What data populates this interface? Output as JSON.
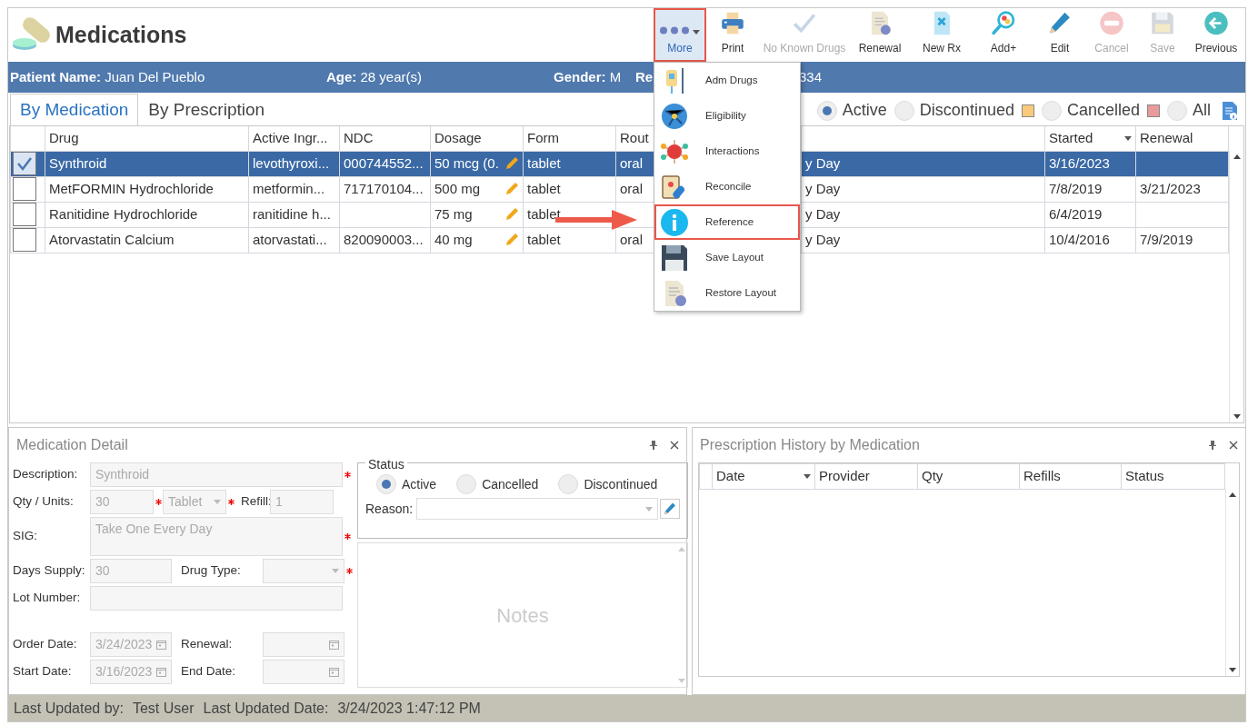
{
  "header": {
    "title": "Medications"
  },
  "toolbar": [
    {
      "label": "More",
      "kind": "more",
      "disabled": false,
      "highlighted": true
    },
    {
      "label": "Print",
      "kind": "print",
      "disabled": false,
      "highlighted": false
    },
    {
      "label": "No Known Drugs",
      "kind": "no-known-drugs",
      "disabled": true,
      "highlighted": false
    },
    {
      "label": "Renewal",
      "kind": "renewal",
      "disabled": false,
      "highlighted": false
    },
    {
      "label": "New Rx",
      "kind": "new-rx",
      "disabled": false,
      "highlighted": false
    },
    {
      "label": "Add+",
      "kind": "add",
      "disabled": false,
      "highlighted": false
    },
    {
      "label": "Edit",
      "kind": "edit",
      "disabled": false,
      "highlighted": false
    },
    {
      "label": "Cancel",
      "kind": "cancel",
      "disabled": true,
      "highlighted": false
    },
    {
      "label": "Save",
      "kind": "save",
      "disabled": true,
      "highlighted": false
    },
    {
      "label": "Previous",
      "kind": "previous",
      "disabled": false,
      "highlighted": false
    }
  ],
  "patient_bar": [
    {
      "label": "Patient Name:",
      "value": "Juan Del Pueblo"
    },
    {
      "label": "Age:",
      "value": "28 year(s)"
    },
    {
      "label": "Gender:",
      "value": "M"
    },
    {
      "label": "Re"
    },
    {
      "value": "334"
    }
  ],
  "more_menu": [
    {
      "label": "Adm Drugs",
      "kind": "adm-drugs",
      "highlighted": false
    },
    {
      "label": "Eligibility",
      "kind": "eligibility",
      "highlighted": false
    },
    {
      "label": "Interactions",
      "kind": "interactions",
      "highlighted": false
    },
    {
      "label": "Reconcile",
      "kind": "reconcile",
      "highlighted": false
    },
    {
      "label": "Reference",
      "kind": "reference",
      "highlighted": true
    },
    {
      "label": "Save Layout",
      "kind": "save-layout",
      "highlighted": false
    },
    {
      "label": "Restore Layout",
      "kind": "restore-layout",
      "highlighted": false
    }
  ],
  "tabs": [
    {
      "label": "By Medication",
      "selected": true
    },
    {
      "label": "By Prescription",
      "selected": false
    }
  ],
  "filters": [
    {
      "label": "Active",
      "selected": true
    },
    {
      "label": "Discontinued",
      "selected": false,
      "color": "#fbc97c"
    },
    {
      "label": "Cancelled",
      "selected": false,
      "color": "#e99a9a"
    },
    {
      "label": "All",
      "selected": false
    }
  ],
  "grid": {
    "columns": [
      {
        "label": "Drug",
        "sorted": false
      },
      {
        "label": "Active Ingr...",
        "sorted": false
      },
      {
        "label": "NDC",
        "sorted": false
      },
      {
        "label": "Dosage",
        "sorted": false,
        "editable": true
      },
      {
        "label": "Form",
        "sorted": false
      },
      {
        "label": "Rout"
      },
      {
        "sorted": false
      },
      {
        "label": "Started",
        "sorted": true
      },
      {
        "label": "Renewal",
        "sorted": false
      }
    ],
    "rows": [
      {
        "checked": true,
        "selected": true,
        "cells": [
          "Synthroid",
          "levothyroxi...",
          "000744552...",
          "50 mcg (0.",
          "tablet",
          "oral",
          "y Day",
          "3/16/2023",
          null
        ]
      },
      {
        "checked": false,
        "selected": false,
        "cells": [
          "MetFORMIN Hydrochloride",
          "metformin...",
          "717170104...",
          "500 mg",
          "tablet",
          "oral",
          "y Day",
          "7/8/2019",
          "3/21/2023"
        ]
      },
      {
        "checked": false,
        "selected": false,
        "cells": [
          "Ranitidine Hydrochloride",
          "ranitidine h...",
          null,
          "75 mg",
          "tablet",
          null,
          "y Day",
          "6/4/2019",
          null
        ]
      },
      {
        "checked": false,
        "selected": false,
        "cells": [
          "Atorvastatin Calcium",
          "atorvastati...",
          "820090003...",
          "40 mg",
          "tablet",
          "oral",
          "y Day",
          "10/4/2016",
          "7/9/2019"
        ]
      }
    ]
  },
  "detail": {
    "title": "Medication Detail",
    "disabled": true,
    "rows": [
      [
        {
          "label": "Description:",
          "kind": "text",
          "value": "Synthroid",
          "required": true
        }
      ],
      [
        {
          "label": "Qty / Units:",
          "kind": "text",
          "value": "30",
          "required": true
        },
        {
          "kind": "select",
          "value": "Tablet",
          "required": true
        },
        {
          "label": "Refill:",
          "kind": "text",
          "value": "1",
          "required": false
        }
      ],
      [
        {
          "label": "SIG:",
          "kind": "textarea",
          "value": "Take One Every Day",
          "required": true
        }
      ],
      [
        {
          "label": "Days Supply:",
          "kind": "text",
          "value": "30",
          "required": false
        },
        {
          "label": "Drug Type:",
          "kind": "select",
          "required": true
        }
      ],
      [
        {
          "label": "Lot Number:",
          "kind": "text",
          "required": false
        }
      ],
      [
        {
          "label": "Order Date:",
          "kind": "date",
          "value": "3/24/2023",
          "required": false
        },
        {
          "label": "Renewal:",
          "kind": "date",
          "required": false
        }
      ],
      [
        {
          "label": "Start Date:",
          "kind": "date",
          "value": "3/16/2023",
          "required": false
        },
        {
          "label": "End Date:",
          "kind": "date",
          "required": false
        }
      ]
    ],
    "status": {
      "title": "Status",
      "options": [
        {
          "label": "Active",
          "selected": true
        },
        {
          "label": "Cancelled",
          "selected": false
        },
        {
          "label": "Discontinued",
          "selected": false
        }
      ],
      "reason_label": "Reason:"
    },
    "notes": {
      "placeholder": "Notes"
    }
  },
  "history": {
    "title": "Prescription History by Medication",
    "columns": [
      {
        "label": "Date",
        "sorted": true
      },
      {
        "label": "Provider",
        "sorted": false
      },
      {
        "label": "Qty",
        "sorted": false
      },
      {
        "label": "Refills",
        "sorted": false
      },
      {
        "label": "Status",
        "sorted": false
      }
    ]
  },
  "status_bar": [
    {
      "label": "Last Updated by:",
      "value": "Test User"
    },
    {
      "label": "Last Updated Date:",
      "value": "3/24/2023 1:47:12 PM"
    }
  ]
}
